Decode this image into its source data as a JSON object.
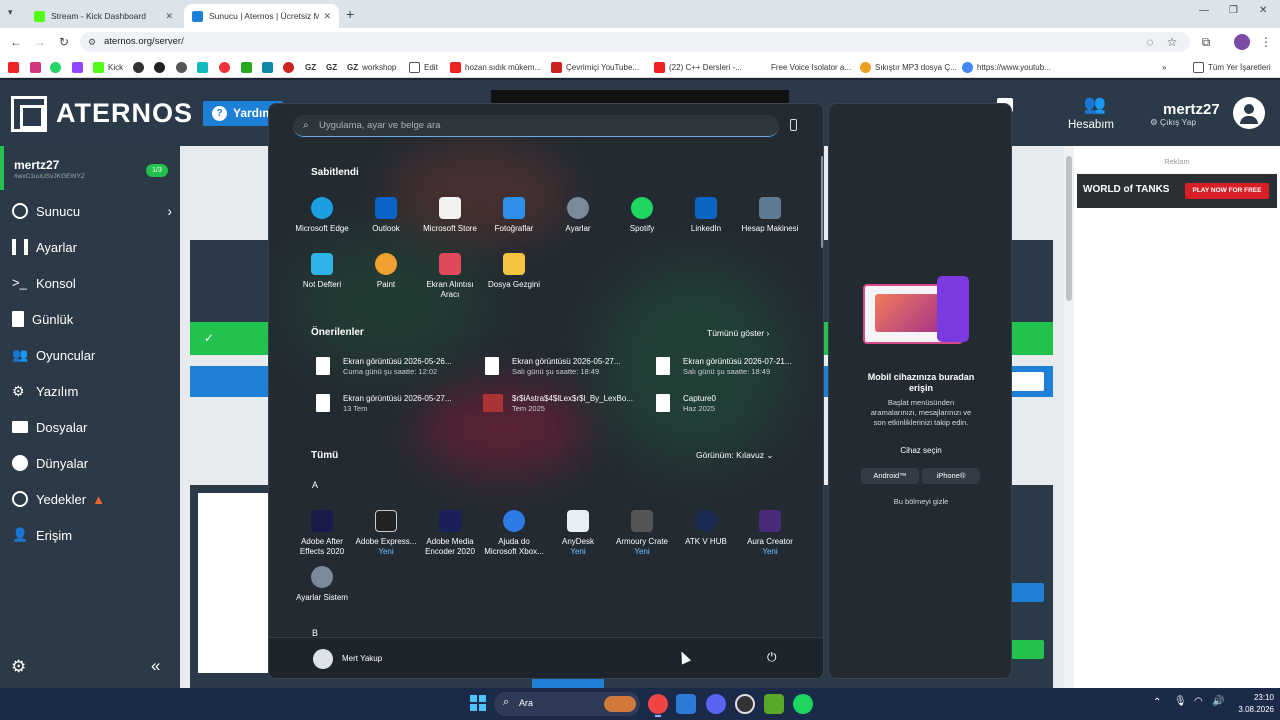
{
  "browser": {
    "tabs": [
      {
        "title": "Stream - Kick Dashboard",
        "color": "#53fc18"
      },
      {
        "title": "Sunucu | Aternos | Ücretsiz Min",
        "color": "#1d7fd6"
      }
    ],
    "url": "aternos.org/server/",
    "bookmarks": [
      "Kick",
      "workshop",
      "Edit",
      "hozan sıdık mükem...",
      "Çevrimiçi YouTube...",
      "(22) C++ Dersleri -...",
      "Free Voice Isolator a...",
      "Sıkıştır MP3 dosya Ç...",
      "https://www.youtub...",
      "Tüm Yer İşaretleri"
    ]
  },
  "aternos": {
    "brand": "ATERNOS",
    "help": "Yardım",
    "account": "Hesabım",
    "user": "mertz27",
    "logout": "Çıkış Yap",
    "server_name": "mertz27",
    "server_id": "#wxC1uuUSvJKGEWYZ",
    "slots": "1/3",
    "nav": [
      "Sunucu",
      "Ayarlar",
      "Konsol",
      "Günlük",
      "Oyuncular",
      "Yazılım",
      "Dosyalar",
      "Dünyalar",
      "Yedekler",
      "Erişim"
    ],
    "ad_label": "Reklam",
    "ad_text": "PLAY NOW FOR FREE"
  },
  "start": {
    "search_placeholder": "Uygulama, ayar ve belge ara",
    "pinned_title": "Sabitlendi",
    "pinned": [
      {
        "name": "Microsoft Edge",
        "color": "#1aa0e0"
      },
      {
        "name": "Outlook",
        "color": "#0a64c8"
      },
      {
        "name": "Microsoft Store",
        "color": "#f2f2f2"
      },
      {
        "name": "Fotoğraflar",
        "color": "#2f8fe8"
      },
      {
        "name": "Ayarlar",
        "color": "#7a8a9a"
      },
      {
        "name": "Spotify",
        "color": "#1ed760"
      },
      {
        "name": "LinkedIn",
        "color": "#0a66c2"
      },
      {
        "name": "Hesap Makinesi",
        "color": "#5f7a93"
      },
      {
        "name": "Not Defteri",
        "color": "#2fb3e6"
      },
      {
        "name": "Paint",
        "color": "#f0a030"
      },
      {
        "name": "Ekran Alıntısı Aracı",
        "color": "#e04a5a"
      },
      {
        "name": "Dosya Gezgini",
        "color": "#f5c542"
      }
    ],
    "rec_title": "Önerilenler",
    "show_all": "Tümünü göster",
    "recommended": [
      {
        "name": "Ekran görüntüsü 2026-05-26...",
        "sub": "Cuma günü şu saatte: 12:02"
      },
      {
        "name": "Ekran görüntüsü 2026-05-27...",
        "sub": "Salı günü şu saatte: 18:49"
      },
      {
        "name": "Ekran görüntüsü 2026-07-21...",
        "sub": "Salı günü şu saatte: 18:49"
      },
      {
        "name": "Ekran görüntüsü 2026-05-27...",
        "sub": "13 Tem"
      },
      {
        "name": "$r$lAstra$4$lLex$r$l_By_LexBo...",
        "sub": "Tem 2025"
      },
      {
        "name": "Capture0",
        "sub": "Haz 2025"
      }
    ],
    "all_title": "Tümü",
    "view_label": "Görünüm: Kılavuz",
    "letter_a": "A",
    "letter_b": "B",
    "all_apps": [
      {
        "name": "Adobe After Effects 2020",
        "badge": "",
        "color": "#1c1a4a"
      },
      {
        "name": "Adobe Express...",
        "badge": "Yeni",
        "color": "#222"
      },
      {
        "name": "Adobe Media Encoder 2020",
        "badge": "",
        "color": "#1b1f5a"
      },
      {
        "name": "Ajuda do Microsoft Xbox...",
        "badge": "",
        "color": "#2c7be5"
      },
      {
        "name": "AnyDesk",
        "badge": "Yeni",
        "color": "#e8eef5"
      },
      {
        "name": "Armoury Crate",
        "badge": "Yeni",
        "color": "#555"
      },
      {
        "name": "ATK V HUB",
        "badge": "",
        "color": "#1b2a52"
      },
      {
        "name": "Aura Creator",
        "badge": "Yeni",
        "color": "#4a2a7a"
      },
      {
        "name": "Ayarlar Sistem",
        "badge": "",
        "color": "#7a8a9a"
      }
    ],
    "user": "Mert Yakup"
  },
  "phone": {
    "title": "Mobil cihazınıza buradan erişin",
    "desc": "Başlat menüsünden aramalarınızı, mesajlarınızı ve son etkinliklerinizi takip edin.",
    "device_label": "Cihaz seçin",
    "android": "Android™",
    "iphone": "iPhone®",
    "hide": "Bu bölmeyi gizle"
  },
  "taskbar": {
    "search": "Ara",
    "time": "23:10",
    "date": "3.08.2026"
  }
}
